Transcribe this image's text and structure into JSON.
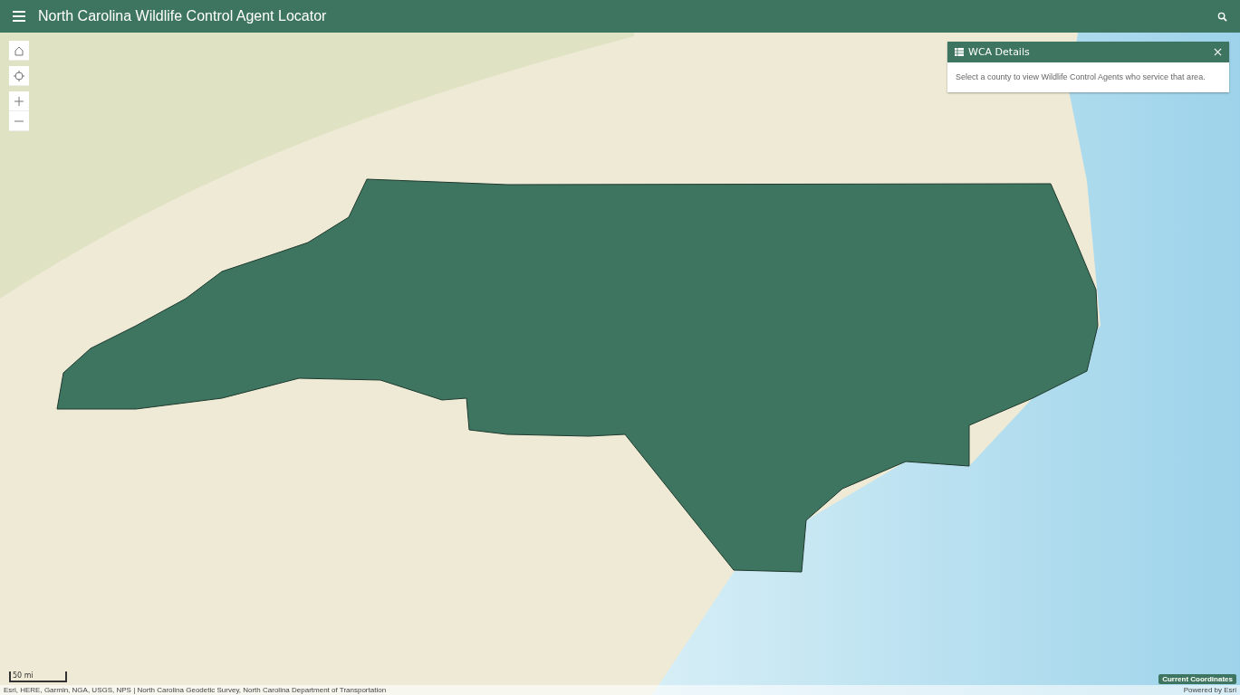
{
  "header": {
    "title": "North Carolina Wildlife Control Agent Locator"
  },
  "details_panel": {
    "title": "WCA Details",
    "message": "Select a county to view Wildlife Control Agents who service that area."
  },
  "scale_bar": {
    "label": "50 mi"
  },
  "attribution": "Esri, HERE, Garmin, NGA, USGS, NPS | North Carolina Geodetic Survey, North Carolina Department of Transportation",
  "coordinates_button": "Current Coordinates",
  "powered_by": "Powered by Esri"
}
